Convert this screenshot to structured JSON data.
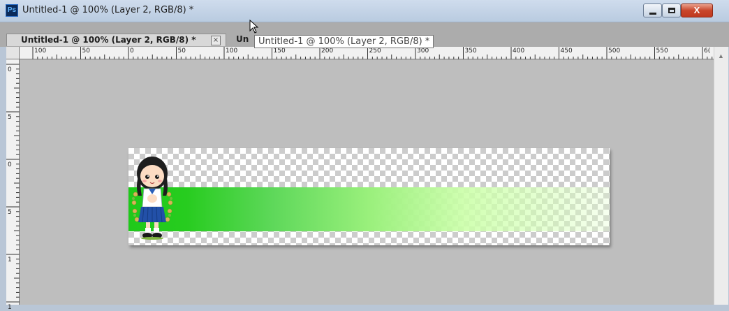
{
  "window": {
    "app_icon": "Ps",
    "title": "Untitled-1 @ 100% (Layer 2, RGB/8) *",
    "close_glyph": "X"
  },
  "tabs": [
    {
      "label": "Untitled-1 @ 100% (Layer 2, RGB/8) *",
      "close": "×",
      "active": true
    },
    {
      "label": "Un",
      "active": false
    }
  ],
  "tooltip": "Untitled-1 @ 100% (Layer 2, RGB/8) *",
  "ruler_h": [
    "100",
    "50",
    "0",
    "50",
    "100",
    "150",
    "200",
    "250",
    "300",
    "350",
    "400",
    "450",
    "500",
    "550",
    "6("
  ],
  "ruler_v": [
    "0",
    "5",
    "0",
    "5",
    "1",
    "1"
  ],
  "colors": {
    "canvas_bg": "#bebebe",
    "band_start": "#1fc91a",
    "band_end": "#ccffaa"
  }
}
